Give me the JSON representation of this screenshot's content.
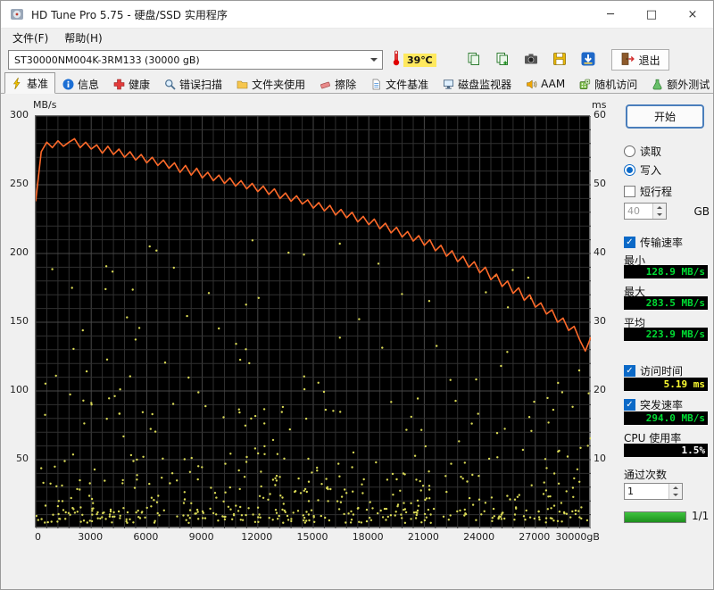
{
  "window": {
    "title": "HD Tune Pro 5.75 - 硬盘/SSD 实用程序",
    "menu": [
      "文件(F)",
      "帮助(H)"
    ],
    "controls": {
      "minimize": "─",
      "maximize": "□",
      "close": "×"
    }
  },
  "toolbar": {
    "drive": "ST30000NM004K-3RM133 (30000 gB)",
    "temperature": "39℃",
    "buttons": [
      "copy",
      "copy-add",
      "camera",
      "save",
      "download"
    ],
    "exit": "退出"
  },
  "tabs": {
    "selected": 0,
    "items": [
      {
        "label": "基准",
        "icon": "benchmark"
      },
      {
        "label": "信息",
        "icon": "info"
      },
      {
        "label": "健康",
        "icon": "health"
      },
      {
        "label": "错误扫描",
        "icon": "error-scan"
      },
      {
        "label": "文件夹使用",
        "icon": "folder"
      },
      {
        "label": "擦除",
        "icon": "erase"
      },
      {
        "label": "文件基准",
        "icon": "file-benchmark"
      },
      {
        "label": "磁盘监视器",
        "icon": "disk-monitor"
      },
      {
        "label": "AAM",
        "icon": "speaker"
      },
      {
        "label": "随机访问",
        "icon": "dice"
      },
      {
        "label": "额外测试",
        "icon": "flask"
      }
    ]
  },
  "panel": {
    "start": "开始",
    "read": "读取",
    "write": "写入",
    "short_stroke": "短行程",
    "stroke_value": "40",
    "stroke_unit": "GB",
    "transfer_rate": "传输速率",
    "min_label": "最小",
    "min_value": "128.9 MB/s",
    "max_label": "最大",
    "max_value": "283.5 MB/s",
    "avg_label": "平均",
    "avg_value": "223.9 MB/s",
    "access_time": "访问时间",
    "access_value": "5.19 ms",
    "burst_rate": "突发速率",
    "burst_value": "294.0 MB/s",
    "cpu_label": "CPU 使用率",
    "cpu_value": "1.5%",
    "pass_label": "通过次数",
    "pass_value": "1",
    "progress_label": "1/1"
  },
  "chart_data": {
    "type": "line",
    "title": "HD Tune sequential write benchmark",
    "x_axis": {
      "min": 0,
      "max": 30000,
      "tick_labels": [
        "0",
        "3000",
        "6000",
        "9000",
        "12000",
        "15000",
        "18000",
        "21000",
        "24000",
        "27000",
        "30000gB"
      ]
    },
    "y_left": {
      "label": "MB/s",
      "min": 0,
      "max": 300,
      "ticks": [
        300,
        250,
        200,
        150,
        100,
        50
      ]
    },
    "y_right": {
      "label": "ms",
      "min": 0,
      "max": 60,
      "ticks": [
        60,
        50,
        40,
        30,
        20,
        10
      ]
    },
    "grid": {
      "x_step": 600,
      "y_step_mbs": 10,
      "minor_color": "#303030",
      "major_color": "#484848"
    },
    "series": [
      {
        "name": "transfer-rate",
        "unit": "MB/s",
        "color": "#ff6a2a",
        "points": [
          [
            0,
            238
          ],
          [
            300,
            274
          ],
          [
            600,
            281
          ],
          [
            900,
            277
          ],
          [
            1200,
            282
          ],
          [
            1500,
            278
          ],
          [
            1800,
            281
          ],
          [
            2100,
            283.5
          ],
          [
            2400,
            277
          ],
          [
            2700,
            281
          ],
          [
            3000,
            276
          ],
          [
            3300,
            279
          ],
          [
            3600,
            273
          ],
          [
            3900,
            278
          ],
          [
            4200,
            272
          ],
          [
            4500,
            276
          ],
          [
            4800,
            270
          ],
          [
            5100,
            274
          ],
          [
            5400,
            268
          ],
          [
            5700,
            272
          ],
          [
            6000,
            266
          ],
          [
            6300,
            270
          ],
          [
            6600,
            264
          ],
          [
            6900,
            268
          ],
          [
            7200,
            262
          ],
          [
            7500,
            266
          ],
          [
            7800,
            259
          ],
          [
            8100,
            264
          ],
          [
            8400,
            257
          ],
          [
            8700,
            262
          ],
          [
            9000,
            255
          ],
          [
            9300,
            259
          ],
          [
            9600,
            253
          ],
          [
            9900,
            257
          ],
          [
            10200,
            251
          ],
          [
            10500,
            255
          ],
          [
            10800,
            249
          ],
          [
            11100,
            253
          ],
          [
            11400,
            247
          ],
          [
            11700,
            251
          ],
          [
            12000,
            245
          ],
          [
            12300,
            249
          ],
          [
            12600,
            243
          ],
          [
            12900,
            247
          ],
          [
            13200,
            240
          ],
          [
            13500,
            244
          ],
          [
            13800,
            238
          ],
          [
            14100,
            242
          ],
          [
            14400,
            236
          ],
          [
            14700,
            239
          ],
          [
            15000,
            233
          ],
          [
            15300,
            237
          ],
          [
            15600,
            231
          ],
          [
            15900,
            235
          ],
          [
            16200,
            228
          ],
          [
            16500,
            232
          ],
          [
            16800,
            226
          ],
          [
            17100,
            230
          ],
          [
            17400,
            223
          ],
          [
            17700,
            227
          ],
          [
            18000,
            221
          ],
          [
            18300,
            225
          ],
          [
            18600,
            218
          ],
          [
            18900,
            222
          ],
          [
            19200,
            215
          ],
          [
            19500,
            219
          ],
          [
            19800,
            212
          ],
          [
            20100,
            216
          ],
          [
            20400,
            209
          ],
          [
            20700,
            213
          ],
          [
            21000,
            206
          ],
          [
            21300,
            210
          ],
          [
            21600,
            202
          ],
          [
            21900,
            206
          ],
          [
            22200,
            198
          ],
          [
            22500,
            202
          ],
          [
            22800,
            194
          ],
          [
            23100,
            198
          ],
          [
            23400,
            190
          ],
          [
            23700,
            194
          ],
          [
            24000,
            186
          ],
          [
            24300,
            190
          ],
          [
            24600,
            181
          ],
          [
            24900,
            185
          ],
          [
            25200,
            176
          ],
          [
            25500,
            180
          ],
          [
            25800,
            171
          ],
          [
            26100,
            175
          ],
          [
            26400,
            166
          ],
          [
            26700,
            170
          ],
          [
            27000,
            161
          ],
          [
            27300,
            164
          ],
          [
            27600,
            156
          ],
          [
            27900,
            159
          ],
          [
            28200,
            150
          ],
          [
            28500,
            153
          ],
          [
            28800,
            144
          ],
          [
            29100,
            147
          ],
          [
            29400,
            137
          ],
          [
            29700,
            129
          ],
          [
            30000,
            139
          ]
        ]
      }
    ],
    "scatter": {
      "name": "access-time",
      "unit": "ms",
      "color": "#d9d955",
      "seed": 1337,
      "count": 560,
      "bands": [
        {
          "range": [
            0.8,
            3.0
          ],
          "fraction": 0.42
        },
        {
          "range": [
            3.0,
            8.0
          ],
          "fraction": 0.26
        },
        {
          "range": [
            8.0,
            18.0
          ],
          "fraction": 0.18
        },
        {
          "range": [
            18.0,
            28.0
          ],
          "fraction": 0.09
        },
        {
          "range": [
            28.0,
            42.0
          ],
          "fraction": 0.05
        }
      ]
    },
    "summary": {
      "min": 128.9,
      "max": 283.5,
      "avg": 223.9,
      "access_time_ms": 5.19,
      "burst_mbs": 294.0,
      "cpu_pct": 1.5
    }
  }
}
